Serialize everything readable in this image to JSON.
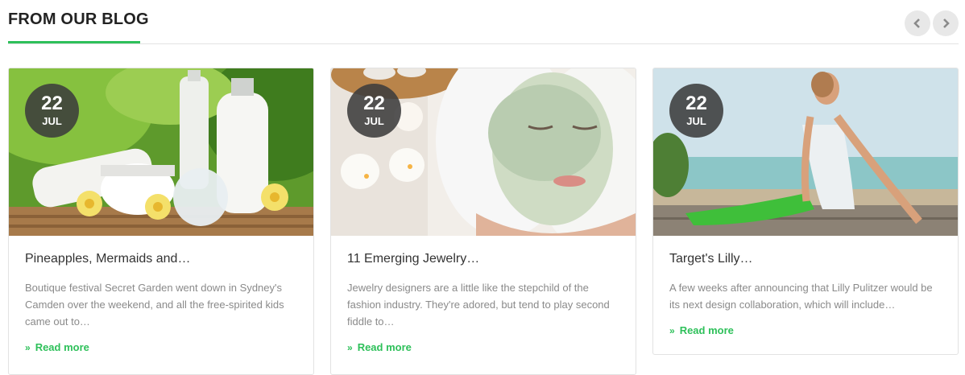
{
  "section": {
    "title": "FROM OUR BLOG",
    "accent_color": "#2ec05a"
  },
  "nav": {
    "prev_icon": "chevron-left-icon",
    "next_icon": "chevron-right-icon"
  },
  "posts": [
    {
      "day": "22",
      "month": "JUL",
      "title": "Pineapples, Mermaids and…",
      "excerpt": "Boutique festival Secret Garden went down in Sydney's Camden over the weekend, and all the free-spirited kids came out to…",
      "read_more": "Read more",
      "image": "spa-cosmetics-bottles"
    },
    {
      "day": "22",
      "month": "JUL",
      "title": "11 Emerging Jewelry…",
      "excerpt": "Jewelry designers are a little like the stepchild of the fashion industry. They're adored, but tend to play second fiddle to…",
      "read_more": "Read more",
      "image": "woman-facial-mask"
    },
    {
      "day": "22",
      "month": "JUL",
      "title": "Target's Lilly…",
      "excerpt": "A few weeks after announcing that Lilly Pulitzer would be its next design collaboration, which will include…",
      "read_more": "Read more",
      "image": "woman-yoga-beach"
    }
  ]
}
